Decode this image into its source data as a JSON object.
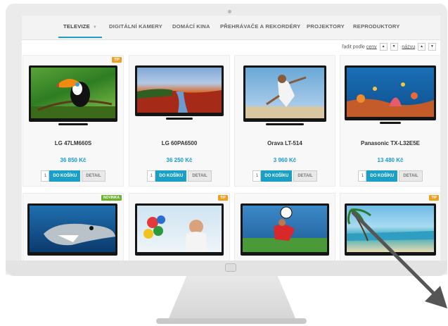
{
  "nav": {
    "tabs": [
      {
        "label": "TELEVIZE",
        "active": true
      },
      {
        "label": "DIGITÁLNÍ KAMERY"
      },
      {
        "label": "DOMÁCÍ KINA"
      },
      {
        "label": "PŘEHRÁVAČE A REKORDÉRY"
      },
      {
        "label": "PROJEKTORY"
      },
      {
        "label": "REPRODUKTORY"
      }
    ]
  },
  "sort": {
    "label": "řadit podle",
    "by_price": "ceny",
    "by_name": "názvu",
    "up": "▲",
    "down": "▼"
  },
  "products": [
    {
      "name": "LG 47LM660S",
      "price": "36 850 Kč",
      "badge": "TIP",
      "qty": "1",
      "cart": "DO KOŠÍKU",
      "detail": "DETAIL"
    },
    {
      "name": "LG 60PA6500",
      "price": "36 250 Kč",
      "badge": "",
      "qty": "1",
      "cart": "DO KOŠÍKU",
      "detail": "DETAIL"
    },
    {
      "name": "Orava LT-514",
      "price": "3 960 Kč",
      "badge": "",
      "qty": "1",
      "cart": "DO KOŠÍKU",
      "detail": "DETAIL"
    },
    {
      "name": "Panasonic TX-L32E5E",
      "price": "13 480 Kč",
      "badge": "",
      "qty": "1",
      "cart": "DO KOŠÍKU",
      "detail": "DETAIL"
    },
    {
      "badge": "NOVINKA"
    },
    {
      "badge": "TIP"
    },
    {
      "badge": ""
    },
    {
      "badge": "TIP"
    }
  ],
  "colors": {
    "accent": "#1aa0c6",
    "price": "#1b9ad0",
    "badge_tip": "#f0a01e",
    "badge_new": "#6bb32e"
  },
  "icons": {
    "dropdown": "chevron-down-icon",
    "cursor": "arrow-cursor-icon"
  }
}
